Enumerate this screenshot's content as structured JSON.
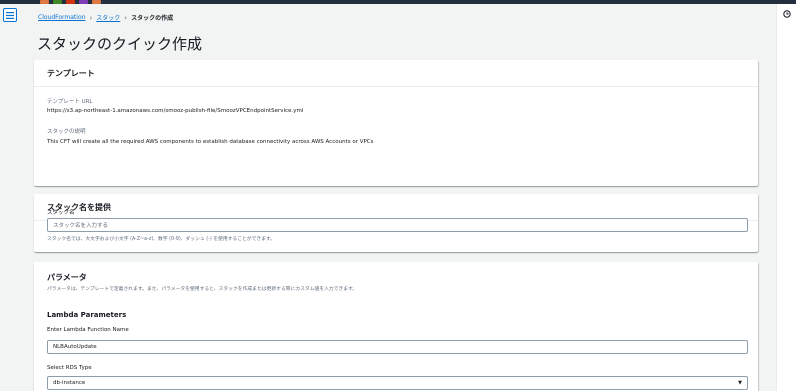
{
  "colors": {
    "accent": "#0972d3",
    "header": "#232f3e",
    "background": "#f2f3f3"
  },
  "top_bar": {
    "app_tiles": [
      "#e07941",
      "#3f8624",
      "#d13212",
      "#7d3bb8",
      "#e07941"
    ]
  },
  "breadcrumb": {
    "item1": "CloudFormation",
    "item2": "スタック",
    "current": "スタックの作成"
  },
  "page": {
    "title": "スタックのクイック作成"
  },
  "template_section": {
    "title": "テンプレート",
    "url_label": "テンプレート URL",
    "url_value": "https://s3.ap-northeast-1.amazonaws.com/smooz-publish-file/SmoozVPCEndpointService.yml",
    "desc_label": "スタックの説明",
    "desc_value": "This CFT will create all the required AWS components to establish database connectivity across AWS Accounts or VPCs"
  },
  "stack_name_section": {
    "title": "スタック名を提供",
    "field_label": "スタック名",
    "placeholder": "スタック名を入力する",
    "hint": "スタック名では、大文字および小文字 (A-Z~a-z)、数字 (0-9)、ダッシュ (-) を使用することができます。"
  },
  "parameters_section": {
    "title": "パラメータ",
    "description": "パラメータは、テンプレートで定義されます。また、パラメータを使用すると、スタックを作成または更新する際にカスタム値を入力できます。",
    "group_title": "Lambda Parameters",
    "lambda_label": "Enter Lambda Function Name",
    "lambda_value": "NLBAutoUpdate",
    "rds_label": "Select RDS Type",
    "rds_value": "db-instance"
  },
  "icons": {
    "menu": "hamburger-menu-icon",
    "clock": "clock-icon",
    "caret": "caret-down-icon"
  }
}
